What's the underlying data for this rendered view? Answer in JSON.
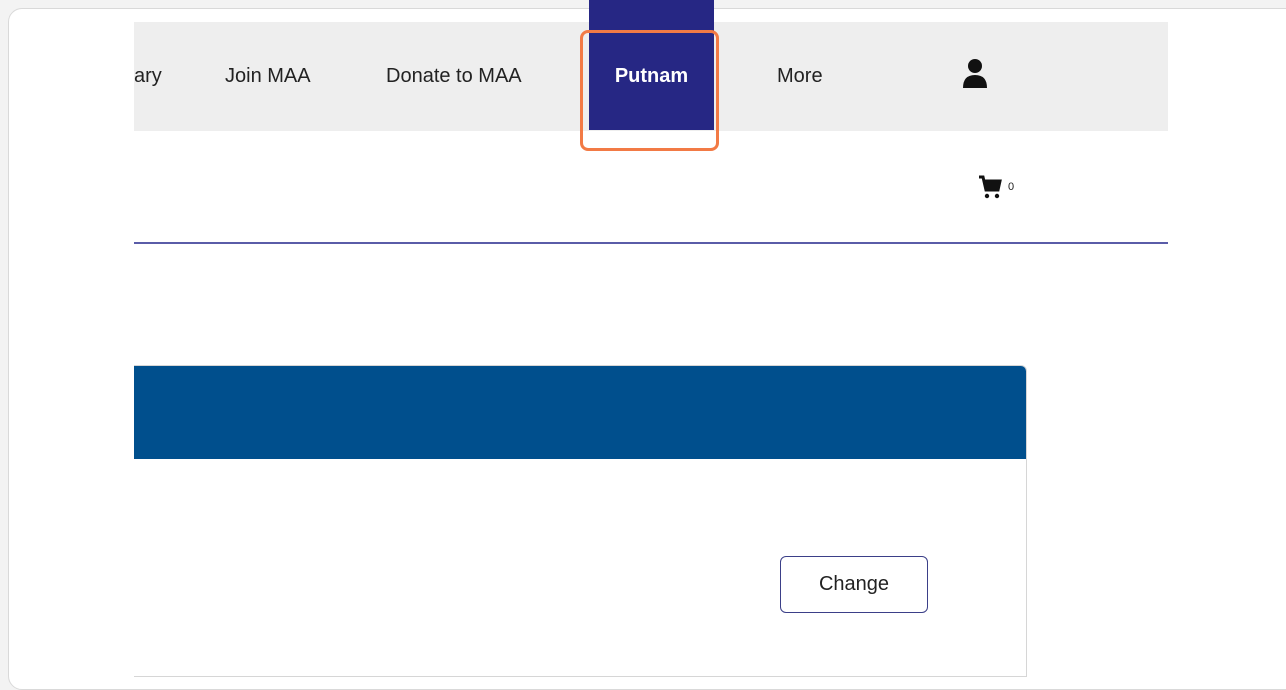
{
  "nav": {
    "items": [
      {
        "label": "ary"
      },
      {
        "label": "Join MAA"
      },
      {
        "label": "Donate to MAA"
      },
      {
        "label": "Putnam"
      },
      {
        "label": "More"
      }
    ],
    "active_index": 3,
    "user_icon": "user-icon"
  },
  "cart": {
    "icon": "cart-icon",
    "count": "0"
  },
  "panel": {
    "change_label": "Change"
  },
  "colors": {
    "nav_background": "#eeeeee",
    "active_background": "#262784",
    "highlight": "#f27a45",
    "panel_header": "#004f8d",
    "divider": "#5a5ca8"
  }
}
